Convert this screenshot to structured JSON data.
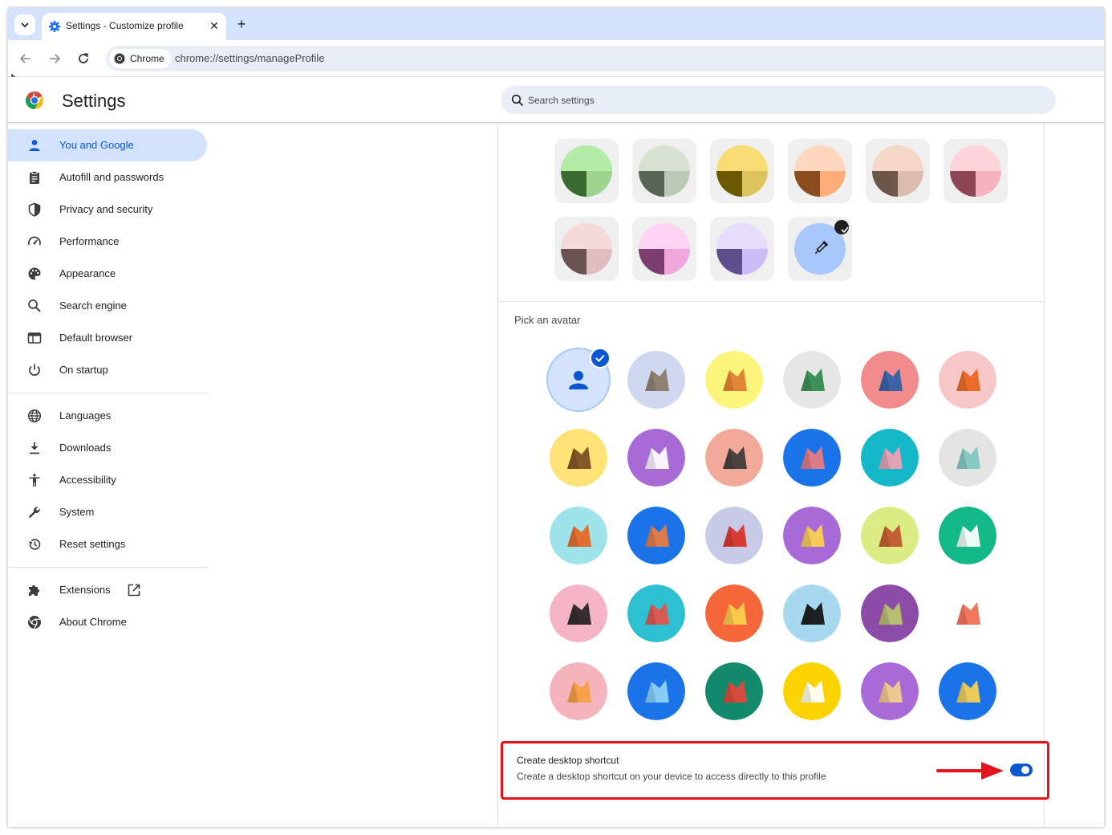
{
  "browser": {
    "tab_title": "Settings - Customize profile",
    "new_tab_label": "+",
    "close_label": "✕",
    "chip_label": "Chrome",
    "url": "chrome://settings/manageProfile"
  },
  "header": {
    "title": "Settings",
    "search_placeholder": "Search settings"
  },
  "sidebar": {
    "items": [
      {
        "label": "You and Google",
        "icon": "person-icon",
        "active": true
      },
      {
        "label": "Autofill and passwords",
        "icon": "clipboard-icon"
      },
      {
        "label": "Privacy and security",
        "icon": "shield-icon"
      },
      {
        "label": "Performance",
        "icon": "speedometer-icon"
      },
      {
        "label": "Appearance",
        "icon": "palette-icon"
      },
      {
        "label": "Search engine",
        "icon": "search-icon"
      },
      {
        "label": "Default browser",
        "icon": "browser-window-icon"
      },
      {
        "label": "On startup",
        "icon": "power-icon"
      },
      {
        "label": "Languages",
        "icon": "globe-icon"
      },
      {
        "label": "Downloads",
        "icon": "download-icon"
      },
      {
        "label": "Accessibility",
        "icon": "accessibility-icon"
      },
      {
        "label": "System",
        "icon": "wrench-icon"
      },
      {
        "label": "Reset settings",
        "icon": "history-icon"
      },
      {
        "label": "Extensions",
        "icon": "puzzle-icon"
      },
      {
        "label": "About Chrome",
        "icon": "chrome-icon"
      }
    ]
  },
  "theme_colors": [
    {
      "top": "#b4eca7",
      "left": "#3c6b31",
      "right": "#9fd48f"
    },
    {
      "top": "#d8e2d3",
      "left": "#586455",
      "right": "#bbc8b6"
    },
    {
      "top": "#f8dd75",
      "left": "#6d5a00",
      "right": "#dcc35c"
    },
    {
      "top": "#ffd7bf",
      "left": "#8a4c1d",
      "right": "#ffad78"
    },
    {
      "top": "#f6d8c8",
      "left": "#6e5648",
      "right": "#dcbdad"
    },
    {
      "top": "#ffd4da",
      "left": "#8e4654",
      "right": "#f5b3bf"
    },
    {
      "top": "#f6dadb",
      "left": "#6b5355",
      "right": "#dfbcbf"
    },
    {
      "top": "#ffd3f4",
      "left": "#7e3d71",
      "right": "#f0a8dc"
    },
    {
      "top": "#e6ddfb",
      "left": "#5d4e8e",
      "right": "#cbbdf5"
    }
  ],
  "custom_color": {
    "fill": "#a8c7fa",
    "icon": "eyedropper-icon",
    "selected": true
  },
  "avatar_section": {
    "title": "Pick an avatar",
    "avatars": [
      {
        "name": "default-person-avatar",
        "bg": "#d3e3fd",
        "fg": "#0b57d0",
        "selected": true
      },
      {
        "name": "cat-avatar",
        "bg": "#cfd8f0",
        "fg": "#8a7a66"
      },
      {
        "name": "corgi-avatar",
        "bg": "#fdf47c",
        "fg": "#e07a2f"
      },
      {
        "name": "dragon-avatar",
        "bg": "#e6e6e6",
        "fg": "#2f8a4a"
      },
      {
        "name": "elephant-avatar",
        "bg": "#f28b8b",
        "fg": "#2d5fa8"
      },
      {
        "name": "fox-avatar",
        "bg": "#f7c6c6",
        "fg": "#e8631c"
      },
      {
        "name": "monkey-avatar",
        "bg": "#fde276",
        "fg": "#7a4a22"
      },
      {
        "name": "panda-avatar",
        "bg": "#a86ad6",
        "fg": "#ffffff"
      },
      {
        "name": "penguin-avatar",
        "bg": "#f2a99a",
        "fg": "#3a3a3a"
      },
      {
        "name": "butterfly-avatar",
        "bg": "#1a73e8",
        "fg": "#f07c7c"
      },
      {
        "name": "rabbit-avatar",
        "bg": "#14b8c8",
        "fg": "#f5a0b4"
      },
      {
        "name": "unicorn-avatar",
        "bg": "#e4e4e4",
        "fg": "#7fc7c0"
      },
      {
        "name": "basketball-avatar",
        "bg": "#9ee2ea",
        "fg": "#e8651c"
      },
      {
        "name": "bike-avatar",
        "bg": "#1a73e8",
        "fg": "#f07c3c"
      },
      {
        "name": "bird-avatar",
        "bg": "#c8cbe8",
        "fg": "#d93025"
      },
      {
        "name": "cheese-avatar",
        "bg": "#a86ad6",
        "fg": "#fcd34d"
      },
      {
        "name": "football-avatar",
        "bg": "#dcec84",
        "fg": "#c0532b"
      },
      {
        "name": "sushi-plate-avatar",
        "bg": "#12b886",
        "fg": "#ffffff"
      },
      {
        "name": "sunglasses-avatar",
        "bg": "#f5b3c6",
        "fg": "#222222"
      },
      {
        "name": "sushi-avatar",
        "bg": "#2cc0d0",
        "fg": "#e8534a"
      },
      {
        "name": "tamagotchi-avatar",
        "bg": "#f5673b",
        "fg": "#fcd34d"
      },
      {
        "name": "vinyl-avatar",
        "bg": "#a8d8f0",
        "fg": "#111111"
      },
      {
        "name": "avocado-avatar",
        "bg": "#8d4ca8",
        "fg": "#b8c86a"
      },
      {
        "name": "smiley-avatar",
        "bg": "#ffffff",
        "fg": "#f06a50"
      },
      {
        "name": "ice-cream-avatar",
        "bg": "#f5b3bc",
        "fg": "#f5a040"
      },
      {
        "name": "ice-avatar",
        "bg": "#1a73e8",
        "fg": "#8fd4f5"
      },
      {
        "name": "watermelon-avatar",
        "bg": "#148a6c",
        "fg": "#e8453c"
      },
      {
        "name": "onigiri-avatar",
        "bg": "#fbd400",
        "fg": "#ffffff"
      },
      {
        "name": "pizza-avatar",
        "bg": "#a86ad6",
        "fg": "#f5d08a"
      },
      {
        "name": "sandwich-avatar",
        "bg": "#1a73e8",
        "fg": "#fcd34d"
      }
    ]
  },
  "shortcut": {
    "title": "Create desktop shortcut",
    "description": "Create a desktop shortcut on your device to access directly to this profile",
    "enabled": true,
    "highlight_color": "#e3141b"
  }
}
